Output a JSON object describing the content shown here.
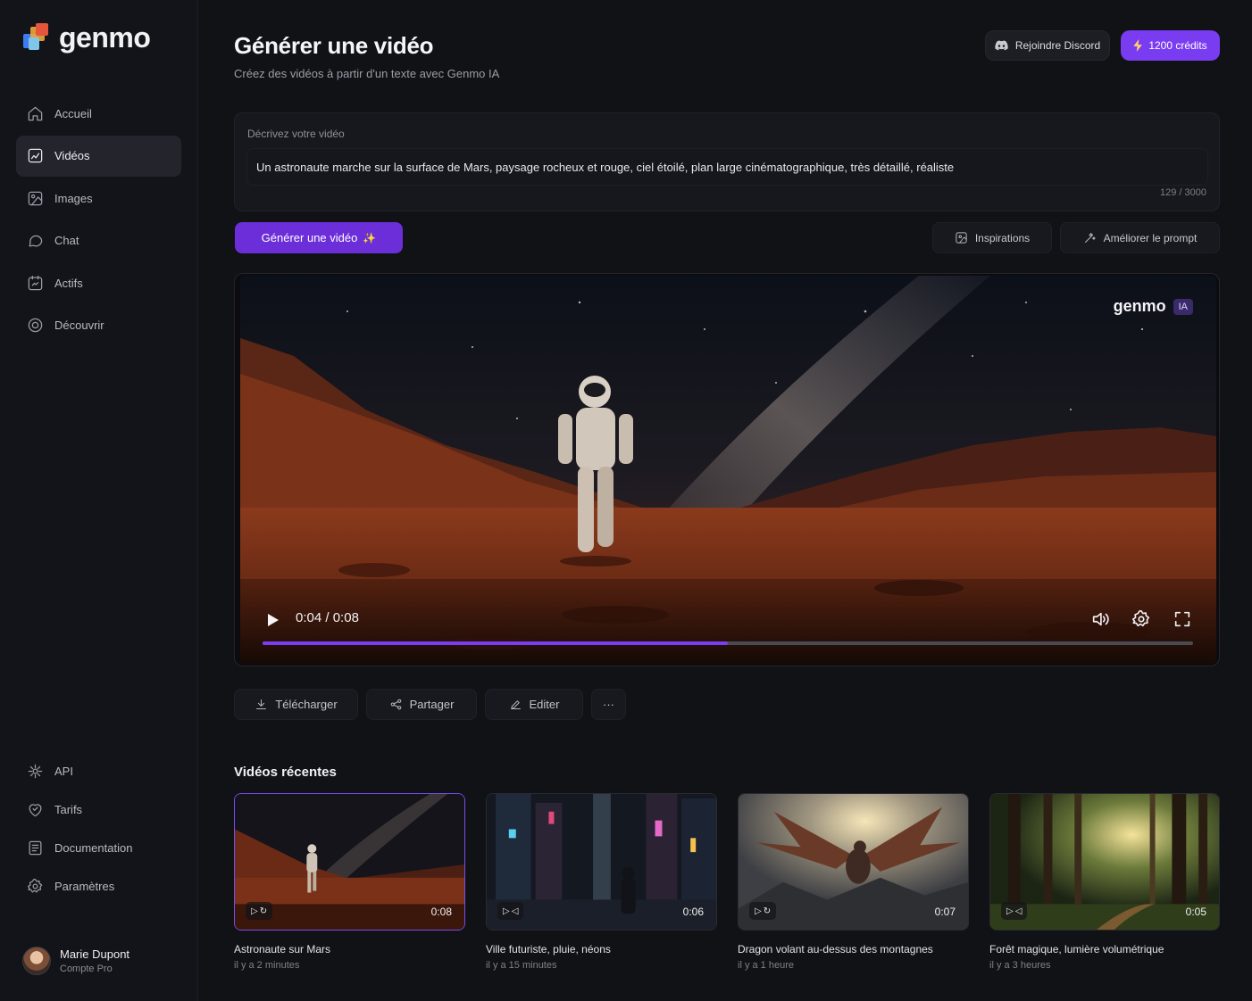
{
  "brand": {
    "name": "genmo"
  },
  "nav_top": [
    {
      "label": "Accueil",
      "icon": "home-icon"
    },
    {
      "label": "Vidéos",
      "icon": "video-icon"
    },
    {
      "label": "Images",
      "icon": "image-icon"
    },
    {
      "label": "Chat",
      "icon": "chat-icon"
    },
    {
      "label": "Actifs",
      "icon": "assets-icon"
    },
    {
      "label": "Découvrir",
      "icon": "discover-icon"
    }
  ],
  "nav_bottom": [
    {
      "label": "API",
      "icon": "api-icon"
    },
    {
      "label": "Tarifs",
      "icon": "pricing-icon"
    },
    {
      "label": "Documentation",
      "icon": "documentation-icon"
    },
    {
      "label": "Paramètres",
      "icon": "settings-icon"
    }
  ],
  "active_nav": "Vidéos",
  "user": {
    "name": "Marie Dupont",
    "plan": "Compte Pro"
  },
  "header": {
    "title": "Générer une vidéo",
    "subtitle": "Créez des vidéos à partir d'un texte avec Genmo IA",
    "discord_label": "Rejoindre Discord",
    "credits_label": "1200 crédits"
  },
  "prompt": {
    "label": "Décrivez votre vidéo",
    "value": "Un astronaute marche sur la surface de Mars, paysage rocheux et rouge, ciel étoilé, plan large cinématographique, très détaillé, réaliste",
    "char_count": "129 / 3000"
  },
  "buttons": {
    "generate": "Générer une vidéo",
    "inspirations": "Inspirations",
    "improve": "Améliorer le prompt"
  },
  "player": {
    "watermark": "genmo",
    "watermark_badge": "IA",
    "current_time": "0:04",
    "separator": "/",
    "duration": "0:08",
    "progress": 0.5
  },
  "actions": {
    "download": "Télécharger",
    "share": "Partager",
    "edit": "Editer",
    "more": "···"
  },
  "recent": {
    "title": "Vidéos récentes",
    "items": [
      {
        "title": "Astronaute sur Mars",
        "time": "il y a 2 minutes",
        "duration": "0:08"
      },
      {
        "title": "Ville futuriste, pluie, néons",
        "time": "il y a 15 minutes",
        "duration": "0:06"
      },
      {
        "title": "Dragon volant au-dessus des montagnes",
        "time": "il y a 1 heure",
        "duration": "0:07"
      },
      {
        "title": "Forêt magique, lumière volumétrique",
        "time": "il y a 3 heures",
        "duration": "0:05"
      }
    ]
  },
  "colors": {
    "accent": "#7a3cf0",
    "background": "#111216",
    "sidebar": "#131419"
  }
}
